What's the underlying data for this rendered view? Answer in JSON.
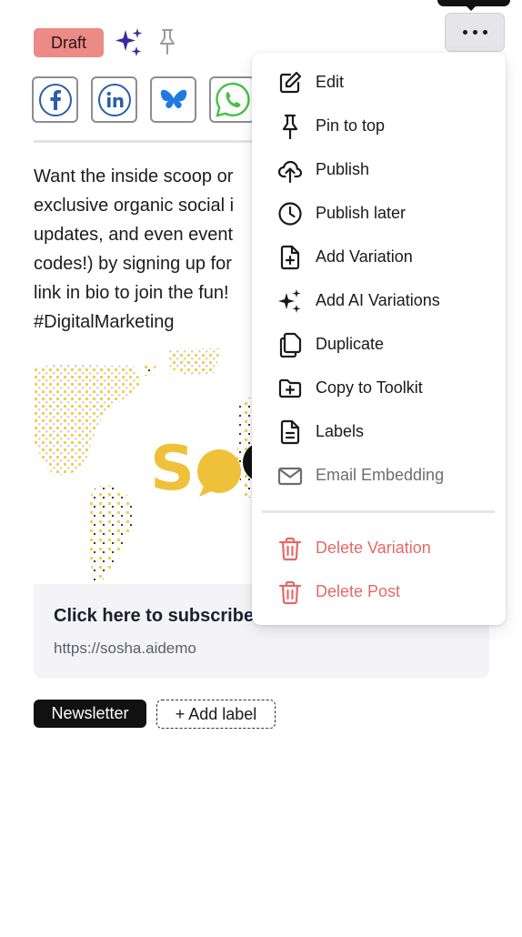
{
  "header": {
    "status_badge": "Draft",
    "status_color": "#ec8a86",
    "ai_icon": "sparkles-icon",
    "pin_icon": "pin-icon",
    "more_icon": "ellipsis-icon"
  },
  "social": [
    {
      "name": "facebook",
      "icon": "facebook-icon"
    },
    {
      "name": "linkedin",
      "icon": "linkedin-icon"
    },
    {
      "name": "bluesky",
      "icon": "bluesky-icon"
    },
    {
      "name": "whatsapp",
      "icon": "whatsapp-icon"
    }
  ],
  "post": {
    "text": "Want the inside scoop or\nexclusive organic social i\nupdates, and even event\ncodes!) by signing up for\nlink in bio to join the fun!\n#DigitalMarketing"
  },
  "link_preview": {
    "title": "Click here to subscribe",
    "url": "https://sosha.aidemo"
  },
  "labels": {
    "items": [
      "Newsletter"
    ],
    "add_label": "+ Add label"
  },
  "menu": {
    "items": [
      {
        "label": "Edit",
        "icon": "edit-icon"
      },
      {
        "label": "Pin to top",
        "icon": "pin-icon"
      },
      {
        "label": "Publish",
        "icon": "cloud-upload-icon"
      },
      {
        "label": "Publish later",
        "icon": "clock-icon"
      },
      {
        "label": "Add Variation",
        "icon": "file-plus-icon"
      },
      {
        "label": "Add AI Variations",
        "icon": "sparkles-icon"
      },
      {
        "label": "Duplicate",
        "icon": "duplicate-icon"
      },
      {
        "label": "Copy to Toolkit",
        "icon": "folder-plus-icon"
      },
      {
        "label": "Labels",
        "icon": "file-text-icon"
      },
      {
        "label": "Email Embedding",
        "icon": "mail-icon"
      }
    ],
    "danger_items": [
      {
        "label": "Delete Variation",
        "icon": "trash-icon"
      },
      {
        "label": "Delete Post",
        "icon": "trash-icon"
      }
    ],
    "danger_color": "#e46a66"
  }
}
